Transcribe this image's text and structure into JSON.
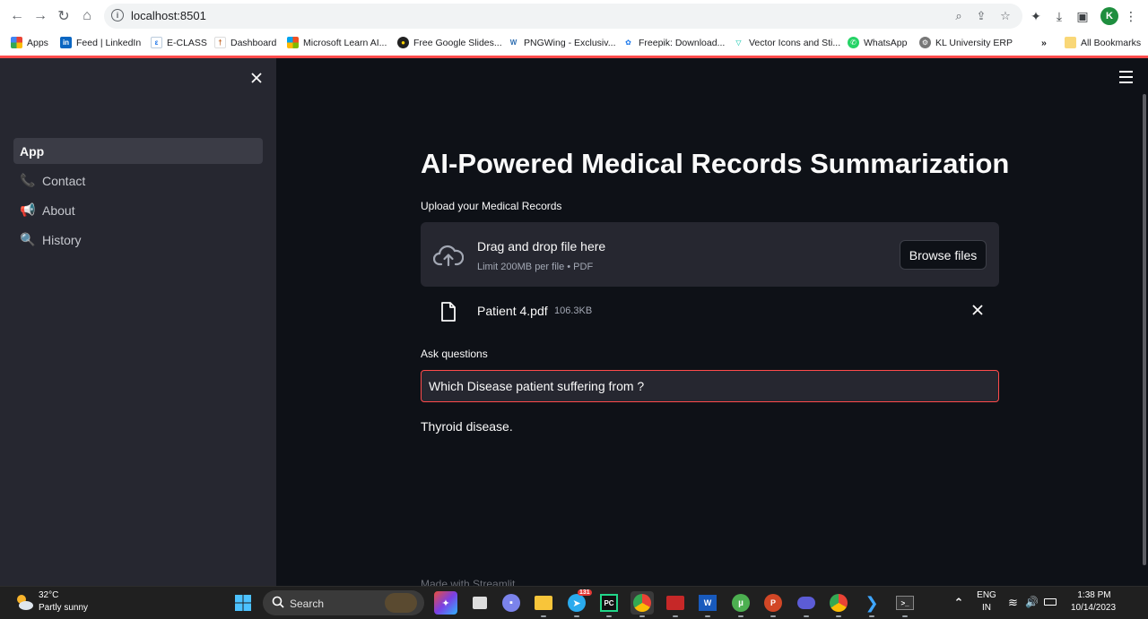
{
  "browser": {
    "url": "localhost:8501",
    "avatar_letter": "K",
    "bookmarks": [
      {
        "label": "Apps"
      },
      {
        "label": "Feed | LinkedIn"
      },
      {
        "label": "E-CLASS"
      },
      {
        "label": "Dashboard"
      },
      {
        "label": "Microsoft Learn AI..."
      },
      {
        "label": "Free Google Slides..."
      },
      {
        "label": "PNGWing - Exclusiv..."
      },
      {
        "label": "Freepik: Download..."
      },
      {
        "label": "Vector Icons and Sti..."
      },
      {
        "label": "WhatsApp"
      },
      {
        "label": "KL University ERP"
      }
    ],
    "overflow": "»",
    "all_bookmarks": "All Bookmarks"
  },
  "sidebar": {
    "items": [
      {
        "label": "App",
        "icon": "",
        "active": true
      },
      {
        "label": "Contact",
        "icon": "phone-icon",
        "active": false
      },
      {
        "label": "About",
        "icon": "megaphone-icon",
        "active": false
      },
      {
        "label": "History",
        "icon": "magnifier-icon",
        "active": false
      }
    ]
  },
  "main": {
    "title": "AI-Powered Medical Records Summarization",
    "upload_label": "Upload your Medical Records",
    "dropzone": {
      "main_text": "Drag and drop file here",
      "sub_text": "Limit 200MB per file • PDF",
      "button": "Browse files"
    },
    "file": {
      "name": "Patient 4.pdf",
      "size": "106.3KB"
    },
    "question_label": "Ask questions",
    "question_value": "Which Disease patient suffering from ?",
    "answer": "Thyroid disease.",
    "footer": "Made with Streamlit"
  },
  "taskbar": {
    "weather_temp": "32°C",
    "weather_desc": "Partly sunny",
    "search": "Search",
    "telegram_badge": "131",
    "lang_1": "ENG",
    "lang_2": "IN",
    "time": "1:38 PM",
    "date": "10/14/2023"
  },
  "colors": {
    "accent": "#ff4b4b",
    "sidebar_bg": "#262730",
    "main_bg": "#0e1117",
    "text": "#fafafa"
  }
}
